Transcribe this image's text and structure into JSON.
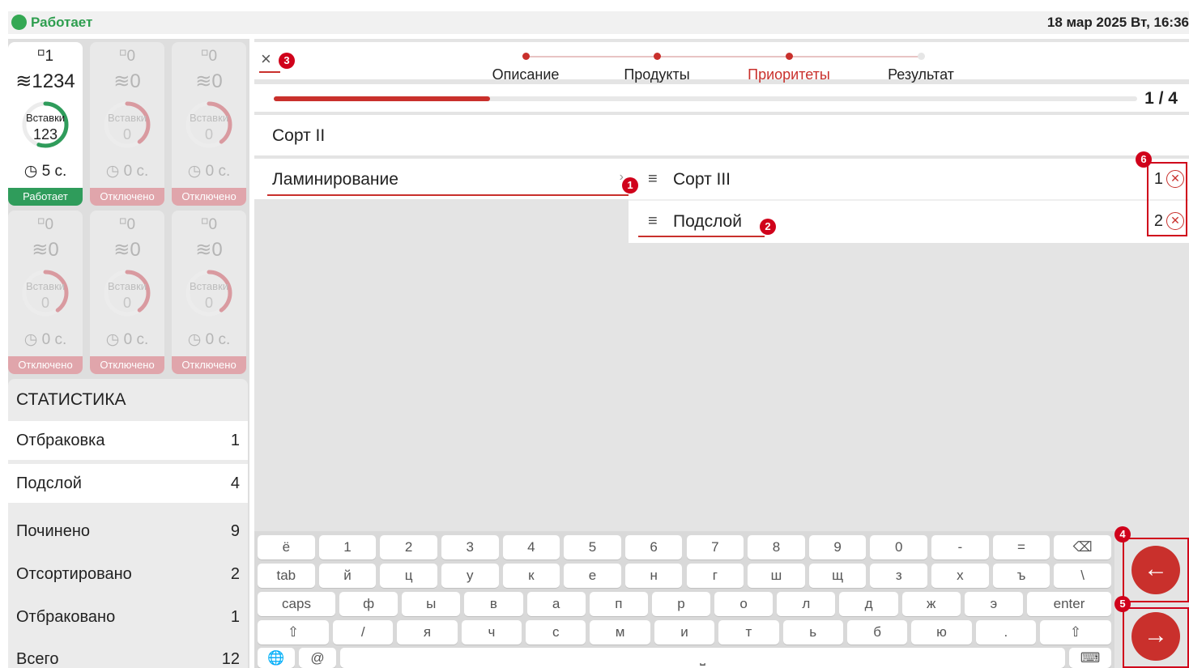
{
  "status": {
    "text": "Работает",
    "datetime": "18 мар 2025 Вт, 16:36"
  },
  "tiles": [
    {
      "head": "⸋1",
      "layers": "≋1234",
      "ring_label": "Вставки",
      "ring_value": "123",
      "time": "◷ 5 с.",
      "state": "Работает",
      "active": true,
      "progress": 0.55
    },
    {
      "head": "⸋0",
      "layers": "≋0",
      "ring_label": "Вставки",
      "ring_value": "0",
      "time": "◷ 0 с.",
      "state": "Отключено",
      "active": false,
      "progress": 0.4
    },
    {
      "head": "⸋0",
      "layers": "≋0",
      "ring_label": "Вставки",
      "ring_value": "0",
      "time": "◷ 0 с.",
      "state": "Отключено",
      "active": false,
      "progress": 0.4
    },
    {
      "head": "⸋0",
      "layers": "≋0",
      "ring_label": "Вставки",
      "ring_value": "0",
      "time": "◷ 0 с.",
      "state": "Отключено",
      "active": false,
      "progress": 0.4
    },
    {
      "head": "⸋0",
      "layers": "≋0",
      "ring_label": "Вставки",
      "ring_value": "0",
      "time": "◷ 0 с.",
      "state": "Отключено",
      "active": false,
      "progress": 0.4
    },
    {
      "head": "⸋0",
      "layers": "≋0",
      "ring_label": "Вставки",
      "ring_value": "0",
      "time": "◷ 0 с.",
      "state": "Отключено",
      "active": false,
      "progress": 0.4
    }
  ],
  "stats": {
    "title": "СТАТИСТИКА",
    "rows": [
      {
        "label": "Отбраковка",
        "value": "1"
      },
      {
        "label": "Подслой",
        "value": "4"
      },
      {
        "label": "Починено",
        "value": "9"
      },
      {
        "label": "Отсортировано",
        "value": "2"
      },
      {
        "label": "Отбраковано",
        "value": "1"
      },
      {
        "label": "Всего",
        "value": "12"
      }
    ]
  },
  "header": {
    "close_icon": "×",
    "steps": [
      {
        "label": "Описание",
        "done": true
      },
      {
        "label": "Продукты",
        "done": true
      },
      {
        "label": "Приоритеты",
        "done": true,
        "current": true
      },
      {
        "label": "Результат",
        "done": false
      }
    ]
  },
  "progress": {
    "text": "1 / 4",
    "fraction": 0.25
  },
  "rows": {
    "sort2": "Сорт II",
    "lamination": "Ламинирование",
    "chevron": "›"
  },
  "priorities": [
    {
      "name": "Сорт III",
      "num": "1",
      "handle": "≡",
      "remove": "✕"
    },
    {
      "name": "Подслой",
      "num": "2",
      "handle": "≡",
      "remove": "✕"
    }
  ],
  "markers": [
    "1",
    "2",
    "3",
    "4",
    "5",
    "6"
  ],
  "keyboard": {
    "row1": [
      "ё",
      "1",
      "2",
      "3",
      "4",
      "5",
      "6",
      "7",
      "8",
      "9",
      "0",
      "-",
      "=",
      "⌫"
    ],
    "row2": [
      "tab",
      "й",
      "ц",
      "у",
      "к",
      "е",
      "н",
      "г",
      "ш",
      "щ",
      "з",
      "х",
      "ъ",
      "\\"
    ],
    "row3": [
      "caps",
      "ф",
      "ы",
      "в",
      "а",
      "п",
      "р",
      "о",
      "л",
      "д",
      "ж",
      "э",
      "enter"
    ],
    "row4": [
      "⇧",
      "/",
      "я",
      "ч",
      "с",
      "м",
      "и",
      "т",
      "ь",
      "б",
      "ю",
      ".",
      "⇧"
    ],
    "row5": [
      "🌐",
      "@",
      "⎵",
      "⌨"
    ]
  },
  "nav": {
    "back_icon": "←",
    "forward_icon": "→"
  },
  "colors": {
    "accent": "#c9302c",
    "ok": "#2f9c5b",
    "off": "#e0a5ab"
  }
}
